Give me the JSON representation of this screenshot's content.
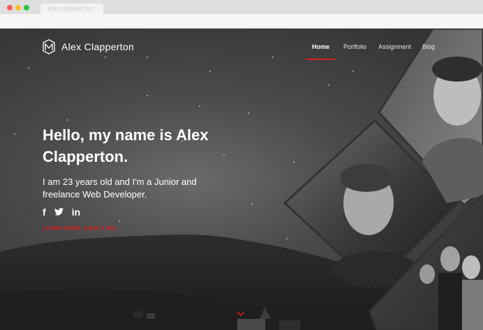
{
  "browser": {
    "tab_title": "alexclapperton"
  },
  "header": {
    "logo_name": "Alex Clapperton",
    "nav": [
      {
        "label": "Home",
        "active": true
      },
      {
        "label": "Portfolio",
        "active": false
      },
      {
        "label": "Assignment",
        "active": false
      },
      {
        "label": "Blog",
        "active": false
      }
    ]
  },
  "hero": {
    "headline": "Hello, my name is Alex Clapperton.",
    "subline": "I am 23 years old and I'm a Junior and freelance Web Developer.",
    "social": [
      {
        "icon": "facebook-icon",
        "glyph": "f"
      },
      {
        "icon": "twitter-icon",
        "glyph": "𝕥"
      },
      {
        "icon": "linkedin-icon",
        "glyph": "in"
      }
    ],
    "learn_more": "LEARN MORE ABOUT ME..."
  },
  "colors": {
    "accent": "#d61d1d",
    "background": "#3a3a3a",
    "text": "#ffffff"
  }
}
